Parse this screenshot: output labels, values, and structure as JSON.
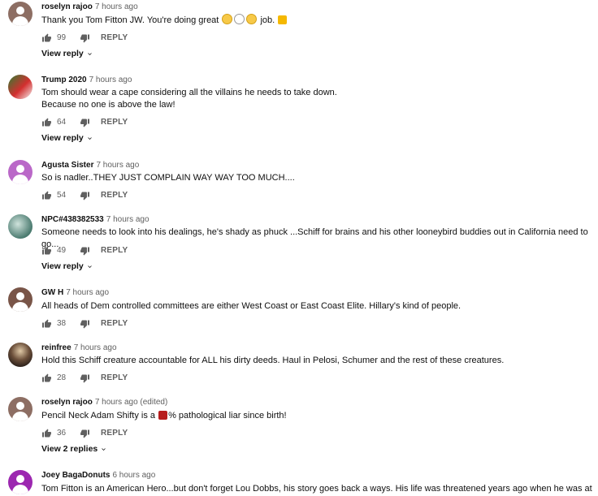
{
  "reply_label": "REPLY",
  "comments": [
    {
      "author": "roselyn rajoo",
      "time": "7 hours ago",
      "text": "Thank you Tom Fitton JW. You're doing great",
      "text_suffix": "job.",
      "likes": "99",
      "view_replies": "View reply",
      "avatar_color": "#8d6e63"
    },
    {
      "author": "Trump 2020",
      "time": "7 hours ago",
      "text": "Tom should wear a cape considering all the villains he needs to take down.\nBecause no one is above the law!",
      "likes": "64",
      "view_replies": "View reply",
      "avatar_color": "#c0392b"
    },
    {
      "author": "Agusta Sister",
      "time": "7 hours ago",
      "text": "So is nadler..THEY JUST COMPLAIN WAY WAY TOO MUCH....",
      "likes": "54",
      "avatar_color": "#ba68c8"
    },
    {
      "author": "NPC#438382533",
      "time": "7 hours ago",
      "text": "Someone needs to look into his dealings, he's shady as phuck ...Schiff for brains and his other looneybird buddies out in California need to go...",
      "likes": "49",
      "view_replies": "View reply",
      "avatar_color": "#4a7a6f"
    },
    {
      "author": "GW H",
      "time": "7 hours ago",
      "text": "All heads of Dem controlled committees are either West Coast or East Coast Elite. Hillary's kind of people.",
      "likes": "38",
      "avatar_color": "#795548"
    },
    {
      "author": "reinfree",
      "time": "7 hours ago",
      "text": "Hold this Schiff creature accountable for ALL his dirty deeds. Haul in Pelosi, Schumer and the rest of these creatures.",
      "likes": "28",
      "avatar_color": "#3e2f2a"
    },
    {
      "author": "roselyn rajoo",
      "time": "7 hours ago (edited)",
      "text_prefix": "Pencil Neck Adam Shifty is a",
      "text": "% pathological liar since birth!",
      "likes": "36",
      "view_replies": "View 2 replies",
      "avatar_color": "#8d6e63"
    },
    {
      "author": "Joey BagaDonuts",
      "time": "6 hours ago",
      "text": "Tom Fitton is an American Hero...but don't forget Lou Dobbs, his story goes back a ways. His life was threatened years ago when he was at",
      "avatar_color": "#9c27b0"
    }
  ]
}
